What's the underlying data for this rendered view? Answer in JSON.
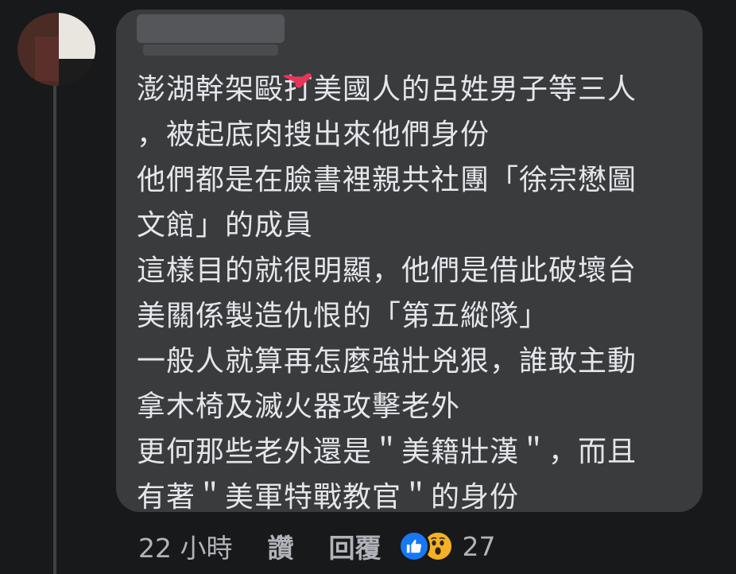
{
  "comment": {
    "lines": [
      "澎湖幹架毆打美國人的呂姓男子等三人",
      "，被起底肉搜出來他們身份",
      "他們都是在臉書裡親共社團「徐宗懋圖",
      "文館」的成員",
      "這樣目的就很明顯，他們是借此破壞台",
      "美關係製造仇恨的「第五縱隊」",
      "一般人就算再怎麼強壯兇狠，誰敢主動",
      "拿木椅及滅火器攻擊老外",
      "更何那些老外還是＂美籍壯漢＂，而且",
      "有著＂美軍特戰教官＂的身份"
    ]
  },
  "actions": {
    "timestamp": "22 小時",
    "like_label": "讚",
    "reply_label": "回覆",
    "reaction_count": "27",
    "reaction_icons": [
      "like-icon",
      "wow-icon"
    ]
  },
  "colors": {
    "background": "#18191a",
    "bubble": "#3a3b3c",
    "text": "#e4e6eb",
    "secondary_text": "#b0b3b8",
    "like_blue": "#1877f2",
    "wow_yellow": "#f7b125"
  }
}
